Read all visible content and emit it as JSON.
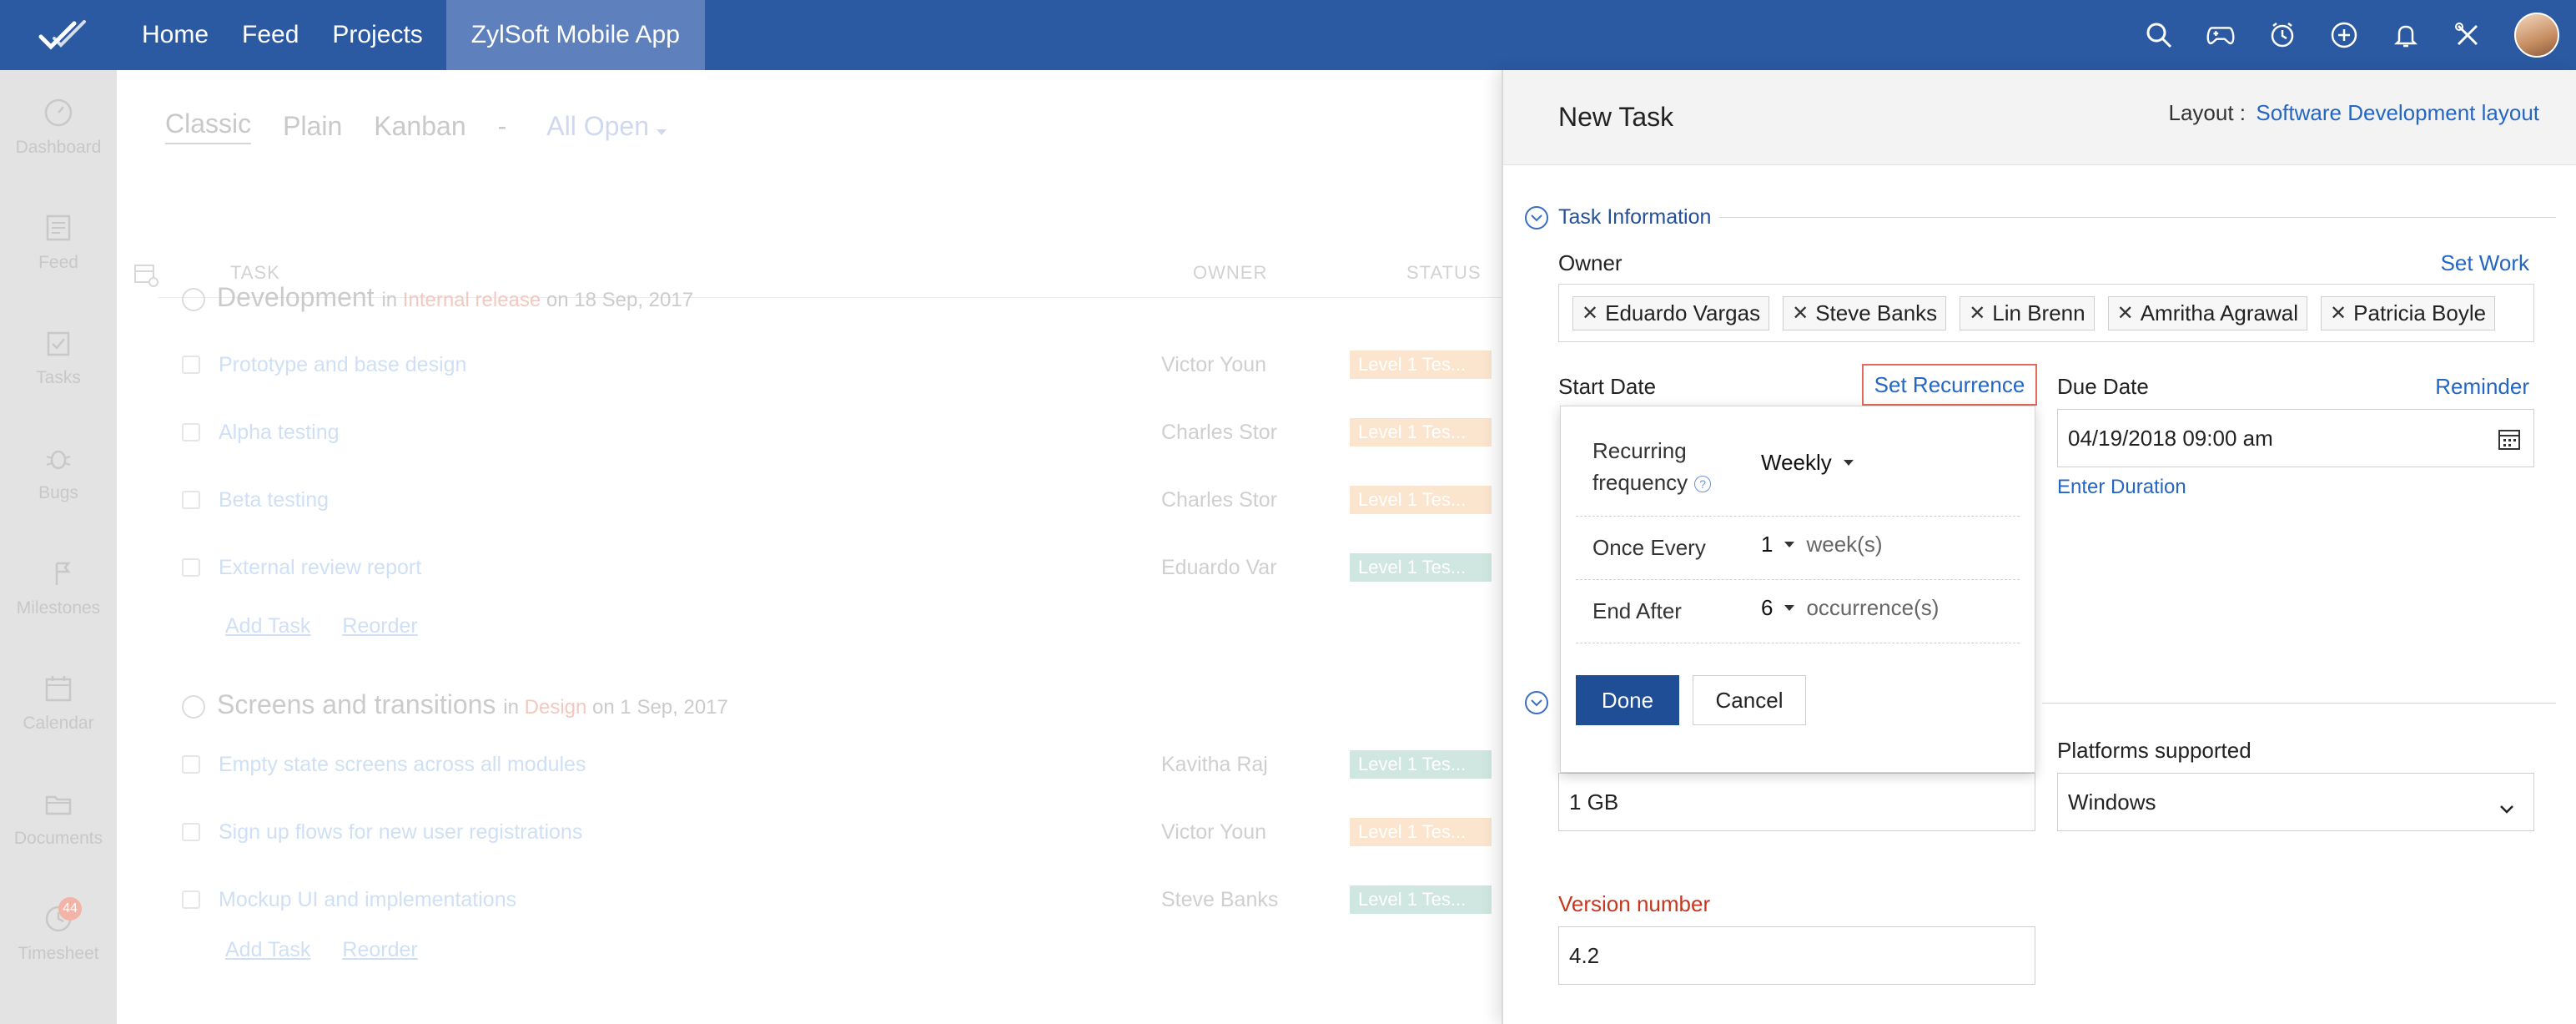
{
  "topbar": {
    "nav": [
      "Home",
      "Feed",
      "Projects"
    ],
    "active_project": "ZylSoft Mobile App",
    "icons": [
      "search-icon",
      "gamepad-icon",
      "timer-icon",
      "add-icon",
      "bell-icon",
      "tools-icon",
      "avatar"
    ]
  },
  "sidebar": {
    "items": [
      {
        "label": "Dashboard",
        "icon": "dashboard-icon"
      },
      {
        "label": "Feed",
        "icon": "feed-icon"
      },
      {
        "label": "Tasks",
        "icon": "tasks-icon"
      },
      {
        "label": "Bugs",
        "icon": "bug-icon"
      },
      {
        "label": "Milestones",
        "icon": "milestone-icon"
      },
      {
        "label": "Calendar",
        "icon": "calendar-icon"
      },
      {
        "label": "Documents",
        "icon": "documents-icon"
      },
      {
        "label": "Timesheet",
        "icon": "timesheet-icon"
      }
    ],
    "timesheet_badge": "44"
  },
  "tasklist": {
    "views": [
      "Classic",
      "Plain",
      "Kanban"
    ],
    "separator": "-",
    "filter": "All Open",
    "columns": {
      "task": "TASK",
      "owner": "OWNER",
      "status": "STATUS"
    },
    "groups": [
      {
        "title": "Development",
        "in_word": "in",
        "list": "Internal release",
        "on_word": "on",
        "date": "18 Sep, 2017",
        "tasks": [
          {
            "name": "Prototype and base design",
            "owner": "Victor Youn",
            "status": "Level 1 Tes..."
          },
          {
            "name": "Alpha testing",
            "owner": "Charles Stor",
            "status": "Level 1 Tes..."
          },
          {
            "name": "Beta testing",
            "owner": "Charles Stor",
            "status": "Level 1 Tes..."
          },
          {
            "name": "External review report",
            "owner": "Eduardo Var",
            "status": "Level 1 Tes..."
          }
        ]
      },
      {
        "title": "Screens and transitions",
        "in_word": "in",
        "list": "Design",
        "on_word": "on",
        "date": "1 Sep, 2017",
        "tasks": [
          {
            "name": "Empty state screens across all modules",
            "owner": "Kavitha Raj",
            "status": "Level 1 Tes..."
          },
          {
            "name": "Sign up flows for new user registrations",
            "owner": "Victor Youn",
            "status": "Level 1 Tes..."
          },
          {
            "name": "Mockup UI and implementations",
            "owner": "Steve Banks",
            "status": "Level 1 Tes..."
          }
        ]
      }
    ],
    "add_task": "Add Task",
    "reorder": "Reorder"
  },
  "panel": {
    "title": "New Task",
    "layout_label": "Layout :",
    "layout_value": "Software Development layout",
    "section_title": "Task Information",
    "owner_label": "Owner",
    "set_work": "Set Work",
    "owners": [
      "Eduardo Vargas",
      "Steve Banks",
      "Lin Brenn",
      "Amritha Agrawal",
      "Patricia Boyle"
    ],
    "start_date_label": "Start Date",
    "set_recurrence": "Set Recurrence",
    "due_date_label": "Due Date",
    "reminder": "Reminder",
    "due_date_value": "04/19/2018 09:00 am",
    "enter_duration": "Enter Duration",
    "platforms_label": "Platforms supported",
    "platforms_value": "Windows",
    "size_value": "1 GB",
    "version_label": "Version number",
    "version_value": "4.2"
  },
  "recurrence": {
    "freq_label_1": "Recurring",
    "freq_label_2": "frequency",
    "freq_value": "Weekly",
    "once_every_label": "Once Every",
    "once_every_value": "1",
    "once_every_unit": "week(s)",
    "end_after_label": "End After",
    "end_after_value": "6",
    "end_after_unit": "occurrence(s)",
    "done": "Done",
    "cancel": "Cancel"
  }
}
